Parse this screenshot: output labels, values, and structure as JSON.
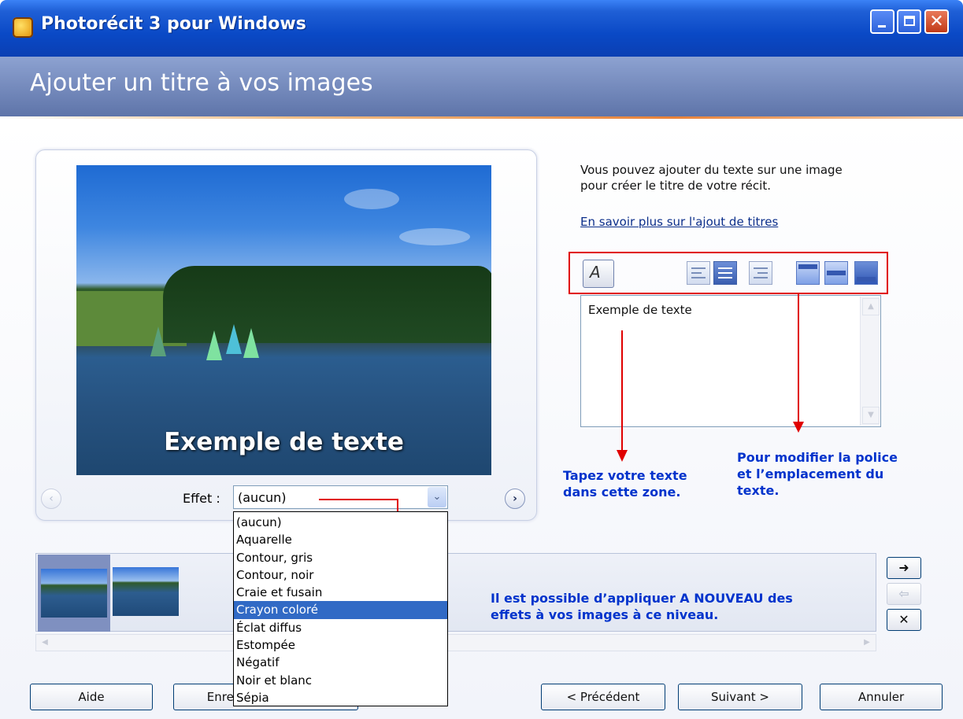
{
  "window": {
    "title": "Photorécit 3 pour Windows",
    "controls": {
      "minimize": "_",
      "maximize": "□",
      "close": "✕"
    }
  },
  "header": {
    "title": "Ajouter un titre à vos images"
  },
  "preview": {
    "caption": "Exemple de texte",
    "prev_icon": "‹",
    "next_icon": "›"
  },
  "effect": {
    "label": "Effet :",
    "selected": "(aucun)",
    "dropdown_icon": "⌄",
    "options": [
      "(aucun)",
      "Aquarelle",
      "Contour, gris",
      "Contour, noir",
      "Craie et fusain",
      "Crayon coloré",
      "Éclat diffus",
      "Estompée",
      "Négatif",
      "Noir et blanc",
      "Sépia"
    ],
    "highlighted_index": 5
  },
  "info": {
    "line1": "Vous pouvez ajouter du texte sur une image",
    "line2": "pour créer le titre de votre récit.",
    "link": "En savoir plus sur l'ajout de titres"
  },
  "toolbar": {
    "font_icon": "A"
  },
  "text_box": {
    "value": "Exemple de texte",
    "scroll_up": "▲",
    "scroll_down": "▼"
  },
  "annotations": {
    "text_zone": [
      "Tapez votre texte",
      "dans cette zone."
    ],
    "font_position": [
      "Pour modifier la police",
      "et l’emplacement du",
      "texte."
    ],
    "effects": [
      "Il est possible d’appliquer A NOUVEAU des",
      "effets à vos images à ce niveau."
    ]
  },
  "filmstrip": {
    "move_right": "➜",
    "move_left": "⇦",
    "remove": "✕",
    "scroll_left": "◀",
    "scroll_right": "▶"
  },
  "buttons": {
    "help": "Aide",
    "save": "Enregistrer le projet",
    "previous": "< Précédent",
    "next": "Suivant >",
    "cancel": "Annuler"
  },
  "colors": {
    "annotation": "#0033cc",
    "arrow": "#e00000",
    "highlight": "#316ac5"
  }
}
